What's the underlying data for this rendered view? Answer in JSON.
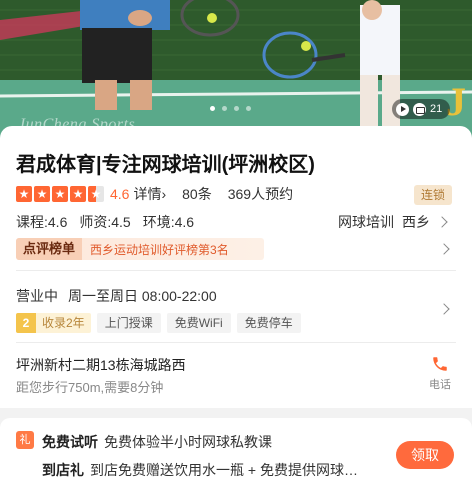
{
  "hero": {
    "watermark": "JunCheng Sports",
    "photo_counter": "21",
    "slide_count": 4,
    "active_slide": 1
  },
  "business": {
    "title": "君成体育|专注网球培训(坪洲校区)",
    "rating": 4.6,
    "stars_filled": 4.5,
    "rating_label": "4.6",
    "details_link": "详情",
    "reviews": "80条",
    "bookings": "369人预约",
    "chain_tag": "连锁",
    "scores": [
      "课程:4.6",
      "师资:4.5",
      "环境:4.6"
    ],
    "category": "网球培训",
    "area": "西乡",
    "rank_badge": "点评榜单",
    "rank_text": "西乡运动培训好评榜第3名"
  },
  "hours": {
    "status": "营业中",
    "time": "周一至周日 08:00-22:00",
    "years_num": "2",
    "years_label": "收录2年",
    "features": [
      "上门授课",
      "免费WiFi",
      "免费停车"
    ]
  },
  "location": {
    "address": "坪洲新村二期13栋海城路西",
    "distance": "距您步行750m,需要8分钟",
    "phone_label": "电话"
  },
  "coupon": {
    "icon_text": "礼",
    "trial_title": "免费试听",
    "trial_desc": "免费体验半小时网球私教课",
    "gift_title": "到店礼",
    "gift_desc": "到店免费赠送饮用水一瓶 + 免费提供网球…",
    "claim_label": "领取"
  },
  "colors": {
    "accent": "#ff6633",
    "chain_bg": "#f6e5cd",
    "rank_text": "#e05a2b",
    "claim_button": "#ff6a3d"
  }
}
